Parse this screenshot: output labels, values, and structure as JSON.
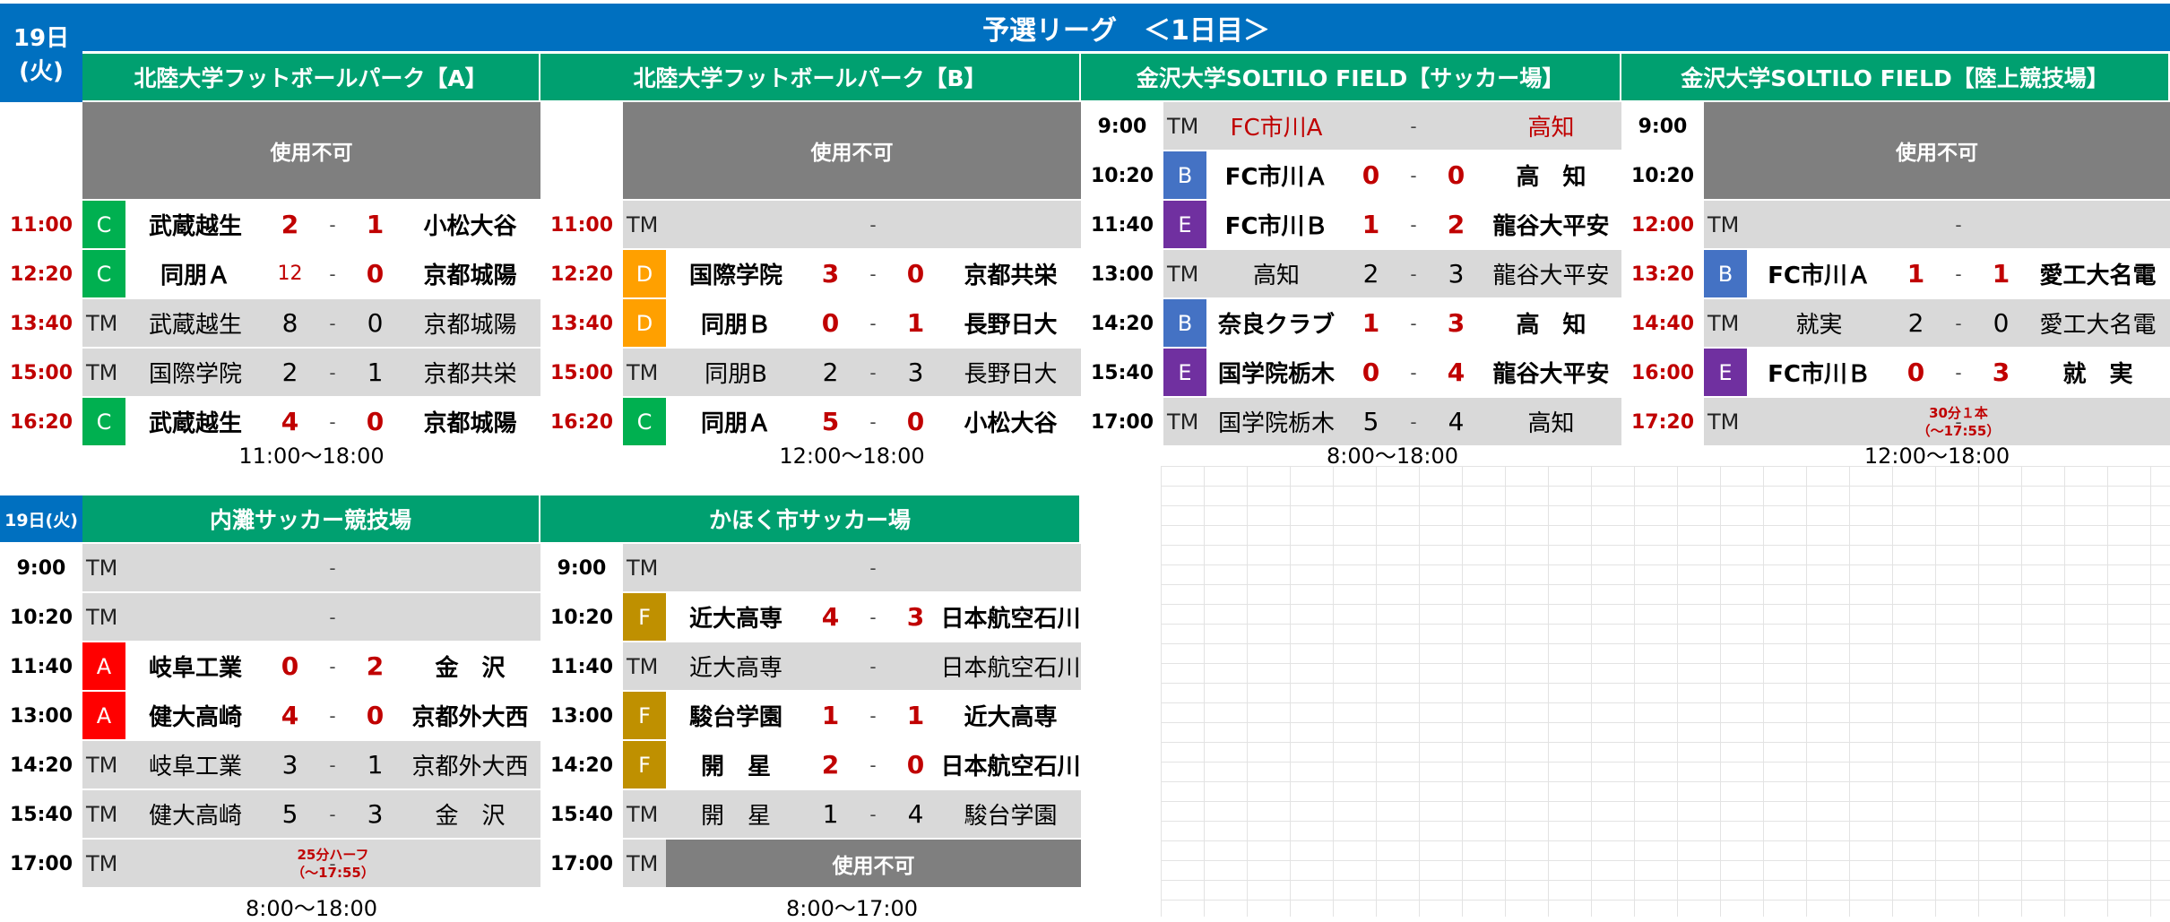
{
  "page_title": "予選リーグ　＜1日目＞",
  "day_label": [
    "19日",
    "(火)"
  ],
  "day_label_small": "19日(火)",
  "dash": "-",
  "colors": {
    "header_blue": "#0070c0",
    "venue_green": "#00a070",
    "gray": "#7f7f7f",
    "row_gray": "#d9d9d9",
    "red": "#c00000",
    "A": "#ff0000",
    "B": "#4472c4",
    "C": "#00b050",
    "D": "#ffa000",
    "E": "#7030a0",
    "F": "#bf9000"
  },
  "venues": [
    {
      "name": "北陸大学フットボールパーク【A】",
      "hours": "11:00～18:00",
      "unavailable": "使用不可",
      "matches": [
        {
          "time": "11:00",
          "group": "C",
          "home": "武蔵越生",
          "hs": "2",
          "as": "1",
          "away": "小松大谷"
        },
        {
          "time": "12:20",
          "group": "C",
          "home": "同朋Ａ",
          "hs": "12",
          "as": "0",
          "away": "京都城陽"
        },
        {
          "time": "13:40",
          "group": "TM",
          "home": "武蔵越生",
          "hs": "8",
          "as": "0",
          "away": "京都城陽"
        },
        {
          "time": "15:00",
          "group": "TM",
          "home": "国際学院",
          "hs": "2",
          "as": "1",
          "away": "京都共栄"
        },
        {
          "time": "16:20",
          "group": "C",
          "home": "武蔵越生",
          "hs": "4",
          "as": "0",
          "away": "京都城陽"
        }
      ]
    },
    {
      "name": "北陸大学フットボールパーク【B】",
      "hours": "12:00～18:00",
      "unavailable": "使用不可",
      "matches": [
        {
          "time": "11:00",
          "group": "TM",
          "home": "",
          "hs": "",
          "as": "",
          "away": ""
        },
        {
          "time": "12:20",
          "group": "D",
          "home": "国際学院",
          "hs": "3",
          "as": "0",
          "away": "京都共栄"
        },
        {
          "time": "13:40",
          "group": "D",
          "home": "同朋Ｂ",
          "hs": "0",
          "as": "1",
          "away": "長野日大"
        },
        {
          "time": "15:00",
          "group": "TM",
          "home": "同朋B",
          "hs": "2",
          "as": "3",
          "away": "長野日大"
        },
        {
          "time": "16:20",
          "group": "C",
          "home": "同朋Ａ",
          "hs": "5",
          "as": "0",
          "away": "小松大谷"
        }
      ]
    },
    {
      "name": "金沢大学SOLTILO FIELD【サッカー場】",
      "hours": "8:00～18:00",
      "matches": [
        {
          "time": "9:00",
          "group": "TM",
          "home": "FC市川A",
          "hs": "",
          "as": "",
          "away": "高知"
        },
        {
          "time": "10:20",
          "group": "B",
          "home": "FC市川Ａ",
          "hs": "0",
          "as": "0",
          "away": "高　知"
        },
        {
          "time": "11:40",
          "group": "E",
          "home": "FC市川Ｂ",
          "hs": "1",
          "as": "2",
          "away": "龍谷大平安"
        },
        {
          "time": "13:00",
          "group": "TM",
          "home": "高知",
          "hs": "2",
          "as": "3",
          "away": "龍谷大平安"
        },
        {
          "time": "14:20",
          "group": "B",
          "home": "奈良クラブ",
          "hs": "1",
          "as": "3",
          "away": "高　知"
        },
        {
          "time": "15:40",
          "group": "E",
          "home": "国学院栃木",
          "hs": "0",
          "as": "4",
          "away": "龍谷大平安"
        },
        {
          "time": "17:00",
          "group": "TM",
          "home": "国学院栃木",
          "hs": "5",
          "as": "4",
          "away": "高知"
        }
      ]
    },
    {
      "name": "金沢大学SOLTILO FIELD【陸上競技場】",
      "hours": "12:00～18:00",
      "unavailable": "使用不可",
      "pre_times": [
        "9:00",
        "10:20"
      ],
      "note": [
        "30分１本",
        "（～17:55）"
      ],
      "matches": [
        {
          "time": "12:00",
          "group": "TM",
          "home": "",
          "hs": "",
          "as": "",
          "away": ""
        },
        {
          "time": "13:20",
          "group": "B",
          "home": "FC市川Ａ",
          "hs": "1",
          "as": "1",
          "away": "愛工大名電"
        },
        {
          "time": "14:40",
          "group": "TM",
          "home": "就実",
          "hs": "2",
          "as": "0",
          "away": "愛工大名電"
        },
        {
          "time": "16:00",
          "group": "E",
          "home": "FC市川Ｂ",
          "hs": "0",
          "as": "3",
          "away": "就　実"
        },
        {
          "time": "17:20",
          "group": "TM",
          "home": "",
          "hs": "",
          "as": "",
          "away": ""
        }
      ]
    },
    {
      "name": "内灘サッカー競技場",
      "hours": "8:00～18:00",
      "note": [
        "25分ハーフ",
        "（～17:55）"
      ],
      "matches": [
        {
          "time": "9:00",
          "group": "TM",
          "home": "",
          "hs": "",
          "as": "",
          "away": ""
        },
        {
          "time": "10:20",
          "group": "TM",
          "home": "",
          "hs": "",
          "as": "",
          "away": ""
        },
        {
          "time": "11:40",
          "group": "A",
          "home": "岐阜工業",
          "hs": "0",
          "as": "2",
          "away": "金　沢"
        },
        {
          "time": "13:00",
          "group": "A",
          "home": "健大高崎",
          "hs": "4",
          "as": "0",
          "away": "京都外大西"
        },
        {
          "time": "14:20",
          "group": "TM",
          "home": "岐阜工業",
          "hs": "3",
          "as": "1",
          "away": "京都外大西"
        },
        {
          "time": "15:40",
          "group": "TM",
          "home": "健大高崎",
          "hs": "5",
          "as": "3",
          "away": "金　沢"
        },
        {
          "time": "17:00",
          "group": "TM",
          "home": "",
          "hs": "",
          "as": "",
          "away": ""
        }
      ]
    },
    {
      "name": "かほく市サッカー場",
      "hours": "8:00～17:00",
      "unavailable": "使用不可",
      "matches": [
        {
          "time": "9:00",
          "group": "TM",
          "home": "",
          "hs": "",
          "as": "",
          "away": ""
        },
        {
          "time": "10:20",
          "group": "F",
          "home": "近大高専",
          "hs": "4",
          "as": "3",
          "away": "日本航空石川"
        },
        {
          "time": "11:40",
          "group": "TM",
          "home": "近大高専",
          "hs": "",
          "as": "",
          "away": "日本航空石川"
        },
        {
          "time": "13:00",
          "group": "F",
          "home": "駿台学園",
          "hs": "1",
          "as": "1",
          "away": "近大高専"
        },
        {
          "time": "14:20",
          "group": "F",
          "home": "開　星",
          "hs": "2",
          "as": "0",
          "away": "日本航空石川"
        },
        {
          "time": "15:40",
          "group": "TM",
          "home": "開　星",
          "hs": "1",
          "as": "4",
          "away": "駿台学園"
        },
        {
          "time": "17:00",
          "group": "TM",
          "home": "",
          "hs": "",
          "as": "",
          "away": ""
        }
      ]
    }
  ]
}
